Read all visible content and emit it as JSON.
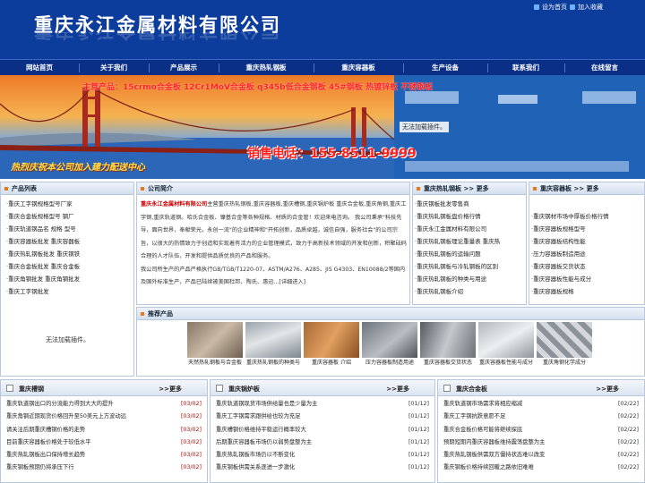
{
  "header": {
    "title": "重庆永江金属材料有限公司",
    "set_home": "设为首页",
    "add_favorite": "加入收藏"
  },
  "nav": [
    "网站首页",
    "关于我们",
    "产品展示",
    "重庆热轧钢板",
    "重庆容器板",
    "生产设备",
    "联系我们",
    "在线留言"
  ],
  "banner": {
    "products": "主营产品：15crmo合金板 12Cr1MoV合金板 q345b低合金钢板 45#钢板 热镀锌板 不锈钢板",
    "phone": "销售电话：155-8511-9999",
    "slogan": "热烈庆祝本公司加入建力配送中心",
    "plugin": "无法加载插件。"
  },
  "left_panel": {
    "title": "产品列表",
    "items": [
      "重庆工字钢规格型号厂家",
      "重庆合金板规格型号 钢厂",
      "重庆轨道钢品名 规格 型号",
      "重庆容器板批发 重庆容器板",
      "重庆热轧钢板批发 重庆钢铁",
      "重庆合金板批发 重庆合金板",
      "重庆角钢批发 重庆角钢批发",
      "重庆工字钢批发"
    ],
    "plugin": "无法加载插件。"
  },
  "intro": {
    "title": "公司简介",
    "company": "重庆永江金属材料有限公司",
    "text1": "主营重庆热轧钢板,重庆容器板,重庆槽钢,重庆锅炉板 重庆合金板,重庆角钢,重庆工字钢,重庆轨道钢。哈氏合金板、镍基合金等各种规格、材质的合金管！欢迎来电咨询。 我公司秉承\"科技先导，面向世界，奉献荣光，永创一流\"的企业精神和\"开拓创新，品质卓越，诚信自强，服务社会\"的公司宗旨，以很大的热情致力于创造和实现着有活力的企业管理模式，致力于高新技术领域的开发和创新，积聚砝码合理的人才队伍，开发和提供品质优良的产品和服务。",
    "text2": "我公司所生产的产品严格执行GB/TGB/T1220-07、ASTM/A276、A285、JIS G4303、EN10088/2等国内及国外标准生产，产品已陆续被美国杜邦、陶氏、惠迅...[详细进入]"
  },
  "hot_panel": {
    "title": "重庆热轧钢板",
    "more": ">> 更多",
    "items": [
      "重庆钢板批发零售商",
      "重庆热轧钢板盘价格行情",
      "重庆永江金属材料有限公司",
      "重庆热轧钢板理论重量表 重庆热",
      "重庆热轧钢板的运输问题",
      "重庆热轧钢板与冷轧钢板的区别",
      "重庆热轧钢板的种类与用途",
      "重庆热轧钢板介绍"
    ]
  },
  "rong_panel": {
    "title": "重庆容器板",
    "more": ">> 更多",
    "items": [
      "重庆钢材市场中厚板价格行情",
      "重庆容器板规格型号",
      "重庆容器板结构性能",
      "压力容器板制造用途",
      "重庆容器板交货状态",
      "重庆容器板性能与成分",
      "重庆容器板规格"
    ]
  },
  "recommend": {
    "title": "推荐产品",
    "items": [
      "天然热轧钢板与合金板",
      "重庆热轧钢板的种类与",
      "重庆容器板 介绍",
      "压力容器板制造用途",
      "重庆容器板交货状态",
      "重庆容器板性能与成分",
      "重庆角钢化学成分"
    ]
  },
  "bottom": [
    {
      "title": "重庆槽钢",
      "more": ">>更多",
      "items": [
        {
          "t": "重庆轨道钢出口的分流能力得到大大的提升",
          "d": "[03/02]"
        },
        {
          "t": "重庆角钢近期现货价格回升至50美元上方波动远",
          "d": "[03/02]"
        },
        {
          "t": "请关注后期重庆槽钢价格的走势",
          "d": "[03/02]"
        },
        {
          "t": "目前重庆容器板价格处于较低水平",
          "d": "[03/02]"
        },
        {
          "t": "重庆热轧钢板出口保持增长趋势",
          "d": "[03/02]"
        },
        {
          "t": "重庆钢板预期仍将承压下行",
          "d": "[03/02]"
        }
      ]
    },
    {
      "title": "重庆锅炉板",
      "more": ">>更多",
      "items": [
        {
          "t": "重庆轨道钢现货市场供给量也是少量为主",
          "d": "[01/12]"
        },
        {
          "t": "重庆工字钢需求跟供给也较为充足",
          "d": "[01/12]"
        },
        {
          "t": "重庆槽钢价格维持平稳运行概率较大",
          "d": "[01/12]"
        },
        {
          "t": "后期重庆容器板市场仍以弱势盘整为主",
          "d": "[01/12]"
        },
        {
          "t": "重庆热轧钢板市场仍以不断变化",
          "d": "[01/12]"
        },
        {
          "t": "重庆钢板供需关系逐进一步激化",
          "d": "[01/12]"
        }
      ]
    },
    {
      "title": "重庆合金板",
      "more": ">>更多",
      "items": [
        {
          "t": "重庆轨道钢市场需求将相应缩减",
          "d": "[02/22]"
        },
        {
          "t": "重庆工字钢抗跌意愿不足",
          "d": "[02/22]"
        },
        {
          "t": "重庆合金板价格可能将继续探底",
          "d": "[02/22]"
        },
        {
          "t": "预期短期内重庆容器板维持震荡盘整为主",
          "d": "[02/22]"
        },
        {
          "t": "重庆热轧钢板供需双方僵持状态难以改变",
          "d": "[02/22]"
        },
        {
          "t": "重庆钢板价格持续回暖之路依旧难难",
          "d": "[02/22]"
        }
      ]
    }
  ]
}
